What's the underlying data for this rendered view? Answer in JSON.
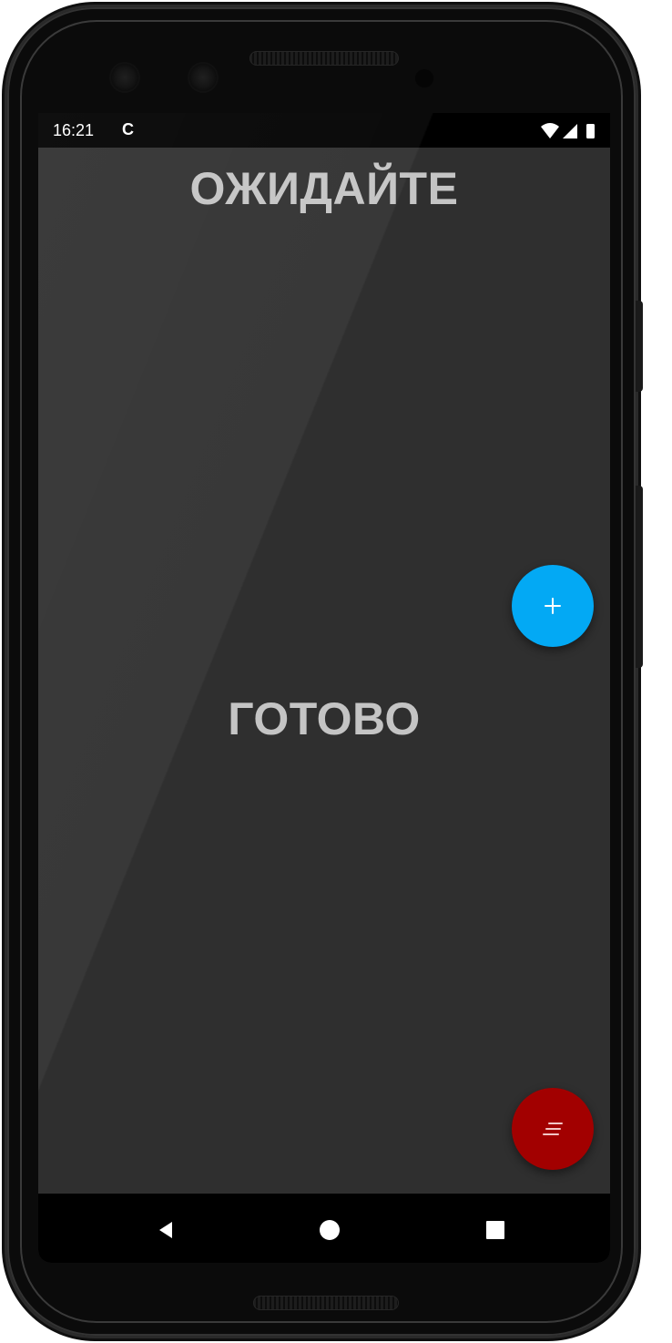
{
  "status_bar": {
    "time": "16:21",
    "sync_glyph": "C",
    "icons": [
      "wifi-icon",
      "cell-signal-icon",
      "battery-icon"
    ]
  },
  "screen": {
    "title_top": "ОЖИДАЙТЕ",
    "title_middle": "ГОТОВО"
  },
  "fabs": {
    "add": {
      "icon": "plus-icon",
      "color": "#03a9f4"
    },
    "menu": {
      "icon": "notes-icon",
      "color": "#a20000"
    }
  },
  "navigation": {
    "items": [
      "back-icon",
      "home-icon",
      "recents-icon"
    ]
  },
  "colors": {
    "background": "#2f2f2f",
    "text": "#c4c4c4",
    "bars": "#000000"
  }
}
